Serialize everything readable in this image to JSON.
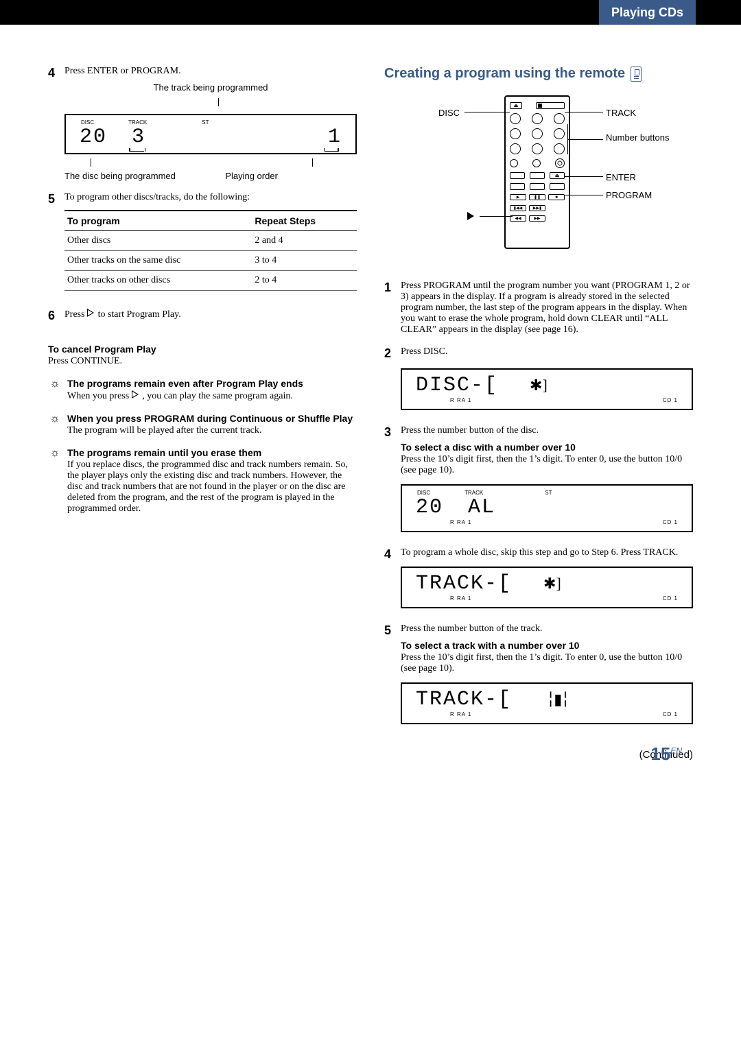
{
  "chapter": "Playing CDs",
  "page_number": "15",
  "page_lang": "EN",
  "continued": "(Continued)",
  "left": {
    "step4": {
      "num": "4",
      "text": "Press ENTER or PROGRAM.",
      "caption_top": "The track being programmed",
      "display": {
        "labels": {
          "disc": "DISC",
          "track": "TRACK",
          "st": "ST"
        },
        "disc_val": "20",
        "track_val": "3",
        "order_val": "1"
      },
      "annot_lower_left": "The disc being programmed",
      "annot_lower_right": "Playing order"
    },
    "step5": {
      "num": "5",
      "text": "To program other discs/tracks, do the following:",
      "table": {
        "headers": [
          "To program",
          "Repeat Steps"
        ],
        "rows": [
          [
            "Other discs",
            "2 and 4"
          ],
          [
            "Other tracks on the same disc",
            "3 to 4"
          ],
          [
            "Other tracks on other discs",
            "2 to 4"
          ]
        ]
      }
    },
    "step6": {
      "num": "6",
      "text_before": "Press ",
      "text_after": " to start Program Play."
    },
    "cancel": {
      "head": "To cancel Program Play",
      "body": "Press CONTINUE."
    },
    "tip1": {
      "head": "The programs remain even after Program Play ends",
      "body_before": "When you press ",
      "body_after": ", you can play the same program again."
    },
    "tip2": {
      "head": "When you press PROGRAM during Continuous or Shuffle Play",
      "body": "The program will be played after the current track."
    },
    "tip3": {
      "head": "The programs remain until you erase them",
      "body": "If you replace discs, the programmed disc and track numbers remain. So, the player plays only the existing disc and track numbers. However, the disc and track numbers that are not found in the player or on the disc are deleted from the program, and the rest of the program is played in the programmed order."
    }
  },
  "right": {
    "section_head": "Creating a program using the remote",
    "remote_labels": {
      "disc": "DISC",
      "track": "TRACK",
      "number_buttons": "Number buttons",
      "enter": "ENTER",
      "program": "PROGRAM",
      "play": "play-icon"
    },
    "step1": {
      "num": "1",
      "text": "Press PROGRAM until the program number you want (PROGRAM 1, 2 or 3) appears in the display. If a program is already stored in the selected program number, the last step of the program appears in the display. When you want to erase the whole program, hold down CLEAR until “ALL CLEAR” appears in the display (see page 16)."
    },
    "step2": {
      "num": "2",
      "text": "Press DISC.",
      "display": {
        "main": "DISC-[",
        "footer_left": "R  RA    1",
        "footer_right": "CD 1"
      }
    },
    "step3": {
      "num": "3",
      "text": "Press the number button of the disc.",
      "sub_head": "To select a disc with a number over 10",
      "sub_body": "Press the 10’s digit first, then the 1’s digit. To enter 0, use the button 10/0 (see page 10).",
      "display": {
        "labels": {
          "disc": "DISC",
          "track": "TRACK",
          "st": "ST"
        },
        "disc_val": "20",
        "track_val": "AL",
        "footer_left": "R  RA    1",
        "footer_right": "CD 1"
      }
    },
    "step4": {
      "num": "4",
      "text": "To program a whole disc, skip this step and go to Step 6. Press TRACK.",
      "display": {
        "main": "TRACK-[",
        "footer_left": "R  RA    1",
        "footer_right": "CD 1"
      }
    },
    "step5": {
      "num": "5",
      "text": "Press the number button of the track.",
      "sub_head": "To select a track with a number over 10",
      "sub_body": "Press the 10’s digit first, then the 1’s digit. To enter 0, use the button 10/0 (see page 10).",
      "display": {
        "main": "TRACK-[",
        "footer_left": "R  RA    1",
        "footer_right": "CD 1"
      }
    }
  }
}
